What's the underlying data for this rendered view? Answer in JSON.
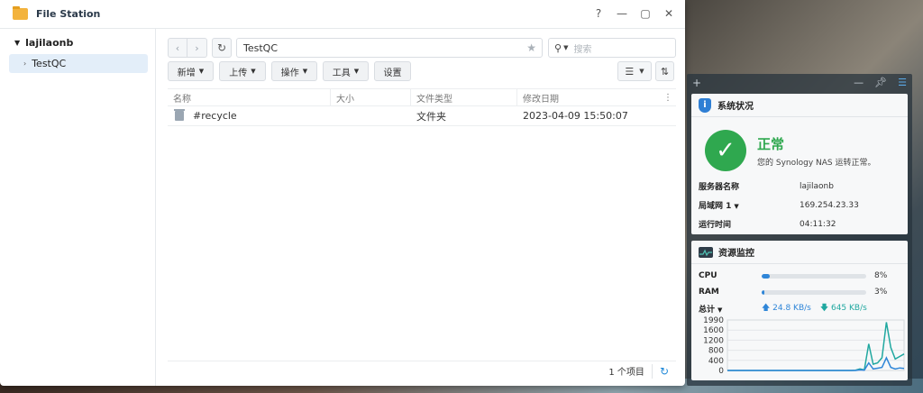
{
  "file_station": {
    "title": "File Station",
    "controls": {
      "help": "?",
      "minimize": "—",
      "maximize": "▢",
      "close": "✕"
    },
    "tree": {
      "root": "lajilaonb",
      "child": "TestQC"
    },
    "path": "TestQC",
    "search_placeholder": "搜索",
    "toolbar": {
      "new": "新增",
      "upload": "上传",
      "action": "操作",
      "tools": "工具",
      "settings": "设置"
    },
    "columns": {
      "name": "名称",
      "size": "大小",
      "type": "文件类型",
      "modified": "修改日期"
    },
    "rows": [
      {
        "name": "#recycle",
        "size": "",
        "type": "文件夹",
        "modified": "2023-04-09 15:50:07"
      }
    ],
    "status_count": "1 个项目"
  },
  "widgets": {
    "system_health": {
      "title": "系统状况",
      "status": "正常",
      "description": "您的 Synology NAS 运转正常。",
      "server_name_label": "服务器名称",
      "server_name": "lajilaonb",
      "lan_label": "局域网 1",
      "lan_ip": "169.254.23.33",
      "uptime_label": "运行时间",
      "uptime": "04:11:32"
    },
    "resource_monitor": {
      "title": "资源监控",
      "cpu_label": "CPU",
      "cpu_pct": 8,
      "cpu_text": "8%",
      "ram_label": "RAM",
      "ram_pct": 3,
      "ram_text": "3%",
      "total_label": "总计",
      "upload": "24.8 KB/s",
      "download": "645 KB/s"
    }
  },
  "chart_data": {
    "type": "line",
    "yticks": [
      "1990",
      "1600",
      "1200",
      "800",
      "400",
      "0"
    ],
    "ylim": [
      0,
      1990
    ],
    "series": [
      {
        "color": "#20a8a0",
        "values": [
          0,
          0,
          0,
          0,
          0,
          0,
          0,
          0,
          0,
          0,
          0,
          0,
          0,
          0,
          0,
          0,
          0,
          0,
          0,
          0,
          0,
          0,
          0,
          0,
          0,
          0,
          0,
          0,
          0,
          10,
          60,
          20,
          1050,
          250,
          300,
          500,
          1900,
          900,
          450,
          550,
          650
        ]
      },
      {
        "color": "#2f86d8",
        "values": [
          0,
          0,
          0,
          0,
          0,
          0,
          0,
          0,
          0,
          0,
          0,
          0,
          0,
          0,
          0,
          0,
          0,
          0,
          0,
          0,
          0,
          0,
          0,
          0,
          0,
          0,
          0,
          0,
          0,
          0,
          20,
          10,
          300,
          60,
          90,
          120,
          500,
          120,
          60,
          100,
          80
        ]
      }
    ]
  }
}
